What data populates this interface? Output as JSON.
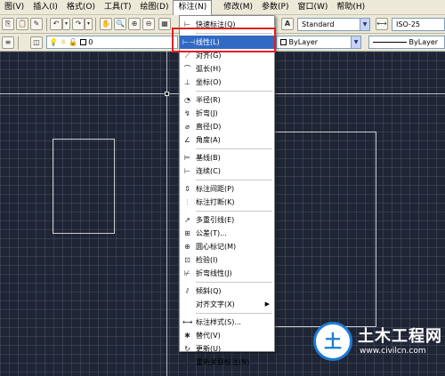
{
  "menubar": {
    "items": [
      "图(V)",
      "插入(I)",
      "格式(O)",
      "工具(T)",
      "绘图(D)",
      "标注(N)",
      "修改(M)",
      "参数(P)",
      "窗口(W)",
      "帮助(H)"
    ]
  },
  "toolbar": {
    "text_style": "Standard",
    "dim_style": "ISO-25",
    "layer_value": "0",
    "color": "ByLayer",
    "linetype": "ByLayer"
  },
  "dimension_menu": {
    "items": [
      {
        "label": "快速标注(Q)",
        "icon": "quick-dim-icon"
      },
      {
        "label": "线性(L)",
        "icon": "linear-dim-icon"
      },
      {
        "label": "对齐(G)",
        "icon": "aligned-dim-icon"
      },
      {
        "label": "弧长(H)",
        "icon": "arc-length-icon"
      },
      {
        "label": "坐标(O)",
        "icon": "ordinate-icon"
      },
      {
        "label": "半径(R)",
        "icon": "radius-icon"
      },
      {
        "label": "折弯(J)",
        "icon": "jogged-icon"
      },
      {
        "label": "直径(D)",
        "icon": "diameter-icon"
      },
      {
        "label": "角度(A)",
        "icon": "angular-icon"
      },
      {
        "label": "基线(B)",
        "icon": "baseline-icon"
      },
      {
        "label": "连续(C)",
        "icon": "continue-icon"
      },
      {
        "label": "标注间距(P)",
        "icon": "dim-space-icon"
      },
      {
        "label": "标注打断(K)",
        "icon": "dim-break-icon"
      },
      {
        "label": "多重引线(E)",
        "icon": "multileader-icon"
      },
      {
        "label": "公差(T)...",
        "icon": "tolerance-icon"
      },
      {
        "label": "圆心标记(M)",
        "icon": "center-mark-icon"
      },
      {
        "label": "检验(I)",
        "icon": "inspection-icon"
      },
      {
        "label": "折弯线性(J)",
        "icon": "jogged-linear-icon"
      },
      {
        "label": "倾斜(Q)",
        "icon": "oblique-icon"
      },
      {
        "label": "对齐文字(X)",
        "icon": ""
      },
      {
        "label": "标注样式(S)...",
        "icon": "dim-style-icon"
      },
      {
        "label": "替代(V)",
        "icon": "override-icon"
      },
      {
        "label": "更新(U)",
        "icon": "update-icon"
      },
      {
        "label": "重新关联标注(N)",
        "icon": "reassociate-icon"
      }
    ]
  },
  "watermark": {
    "title": "土木工程网",
    "url": "www.civilcn.com"
  }
}
